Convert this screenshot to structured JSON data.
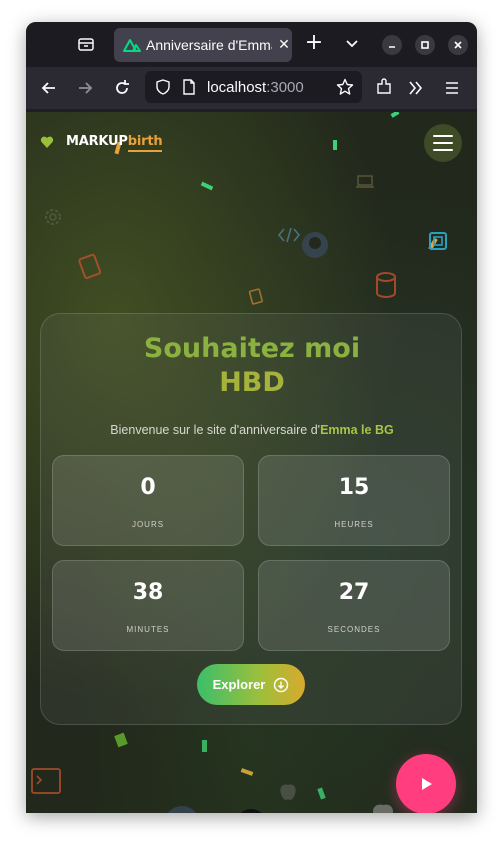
{
  "browser": {
    "tab_title": "Anniversaire d'Emma le BG",
    "url_host": "localhost",
    "url_port": ":3000"
  },
  "header": {
    "brand_main": "MARKUP",
    "brand_accent": "birth"
  },
  "hero": {
    "title_line1": "Souhaitez moi",
    "title_line2": "HBD",
    "welcome_prefix": "Bienvenue sur le site d'anniversaire d'",
    "welcome_name": "Emma le BG"
  },
  "countdown": [
    {
      "value": "0",
      "label": "JOURS"
    },
    {
      "value": "15",
      "label": "HEURES"
    },
    {
      "value": "38",
      "label": "MINUTES"
    },
    {
      "value": "27",
      "label": "SECONDES"
    }
  ],
  "explore_label": "Explorer",
  "colors": {
    "accent_orange": "#e9a23b",
    "title_green": "#8bb240",
    "play_pink": "#ff3d7f"
  }
}
